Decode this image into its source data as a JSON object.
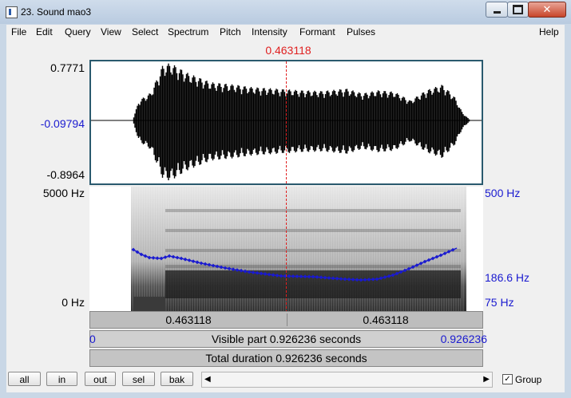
{
  "window": {
    "title": "23. Sound mao3",
    "close_glyph": "✕"
  },
  "menu": [
    "File",
    "Edit",
    "Query",
    "View",
    "Select",
    "Spectrum",
    "Pitch",
    "Intensity",
    "Formant",
    "Pulses",
    "Help"
  ],
  "cursor": {
    "time_label": "0.463118",
    "fraction": 0.5
  },
  "waveform": {
    "max_label": "0.7771",
    "value_label": "-0.09794",
    "min_label": "-0.8964"
  },
  "spectrogram": {
    "top_label": "5000 Hz",
    "bottom_label": "0 Hz"
  },
  "pitch": {
    "top_label": "500 Hz",
    "value_label": "186.6 Hz",
    "bottom_label": "75 Hz"
  },
  "selection": {
    "left_time": "0.463118",
    "right_time": "0.463118"
  },
  "visible": {
    "start": "0",
    "text": "Visible part 0.926236 seconds",
    "end": "0.926236"
  },
  "total": {
    "text": "Total duration 0.926236 seconds"
  },
  "buttons": {
    "all": "all",
    "in": "in",
    "out": "out",
    "sel": "sel",
    "bak": "bak"
  },
  "scrollbar": {
    "left_arrow": "◀",
    "right_arrow": "▶"
  },
  "group": {
    "label": "Group",
    "checked": true,
    "check_glyph": "✓"
  },
  "colors": {
    "cursor": "#e02020",
    "pitch": "#1a1ad0",
    "panel_border": "#2a5a6e"
  }
}
